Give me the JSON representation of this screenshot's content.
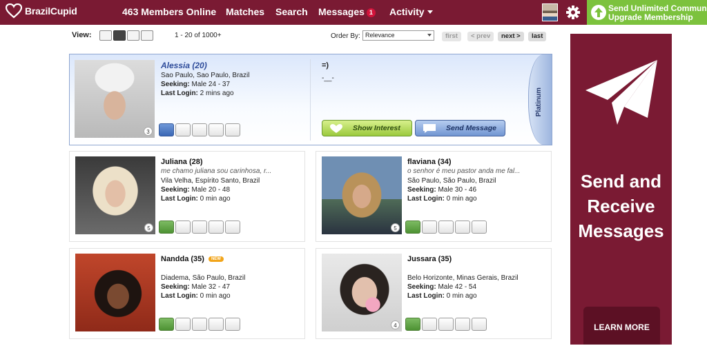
{
  "header": {
    "logo_text": "BrazilCupid",
    "members_online": "463 Members Online",
    "nav": {
      "matches": "Matches",
      "search": "Search",
      "messages": "Messages",
      "messages_count": "1",
      "activity": "Activity"
    },
    "upgrade": {
      "line1": "Send Unlimited Communication",
      "line2": "Upgrade Membership"
    },
    "colors": {
      "brand": "#7a1a33",
      "upgrade_green": "#7cc23d",
      "badge_red": "#d3133b"
    }
  },
  "toolbar": {
    "view_label": "View:",
    "views": [
      "list-view-icon",
      "grid-view-icon",
      "row-view-icon",
      "photo-view-icon"
    ],
    "results": "1 - 20 of 1000+",
    "order_label": "Order By:",
    "order_value": "Relevance",
    "pager": {
      "first": "first",
      "prev": "< prev",
      "next": "next >",
      "last": "last"
    }
  },
  "featured": {
    "name": "Alessia (20)",
    "location": "Sao Paulo, Sao Paulo, Brazil",
    "seeking_label": "Seeking:",
    "seeking": "Male 24 - 37",
    "login_label": "Last Login:",
    "login": "2 mins ago",
    "photo_count": "3",
    "status": "=)",
    "status_sub": "-__-",
    "interest_btn": "Show Interest",
    "message_btn": "Send Message",
    "tier": "Platinum"
  },
  "profiles": [
    {
      "name": "Juliana (28)",
      "tagline": "me chamo juliana sou carinhosa, r...",
      "location": "Vila Velha, Espírito Santo, Brazil",
      "seeking": "Male 20 - 48",
      "login": "0 min ago",
      "photo_count": "5"
    },
    {
      "name": "flaviana (34)",
      "tagline": "o senhor é meu pastor anda me fal...",
      "location": "São Paulo, São Paulo, Brazil",
      "seeking": "Male 30 - 46",
      "login": "0 min ago",
      "photo_count": "5"
    },
    {
      "name": "Nandda (35)",
      "badge": "NEW",
      "location": "Diadema, São Paulo, Brazil",
      "seeking": "Male 32 - 47",
      "login": "0 min ago",
      "photo_count": ""
    },
    {
      "name": "Jussara (35)",
      "location": "Belo Horizonte, Minas Gerais, Brazil",
      "seeking": "Male 42 - 54",
      "login": "0 min ago",
      "photo_count": "4"
    }
  ],
  "labels": {
    "seeking": "Seeking:",
    "login": "Last Login:"
  },
  "ad": {
    "title": "Send and\nReceive\nMessages",
    "cta": "LEARN MORE"
  }
}
